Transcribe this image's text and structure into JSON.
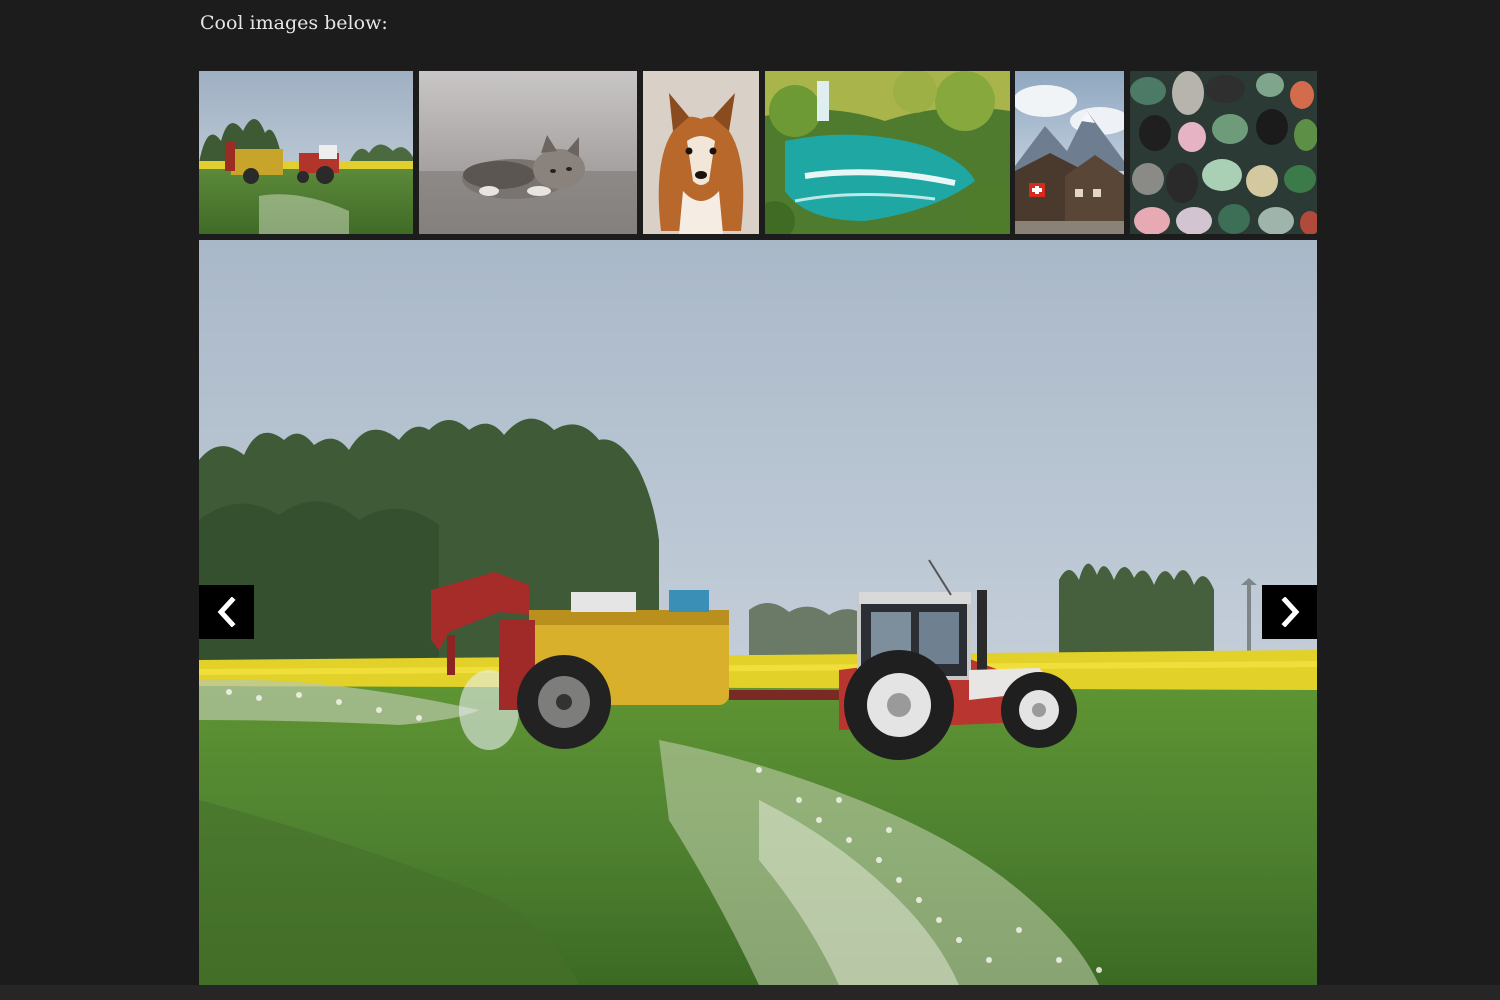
{
  "intro": {
    "text": "Cool images below:"
  },
  "gallery": {
    "selected_index": 0,
    "thumbnails": [
      {
        "subject": "tractor spraying field"
      },
      {
        "subject": "kitten lying on gravel"
      },
      {
        "subject": "sheltie dog portrait"
      },
      {
        "subject": "waterfall and turquoise lake"
      },
      {
        "subject": "swiss mountain village"
      },
      {
        "subject": "polished gemstones"
      }
    ],
    "main_image": {
      "subject": "tractor spraying field"
    },
    "prev_icon": "chevron-left-icon",
    "next_icon": "chevron-right-icon"
  },
  "colors": {
    "page_background": "#1c1c1c",
    "text": "#e6e6e6",
    "nav_background": "#000000",
    "nav_icon": "#ffffff"
  }
}
